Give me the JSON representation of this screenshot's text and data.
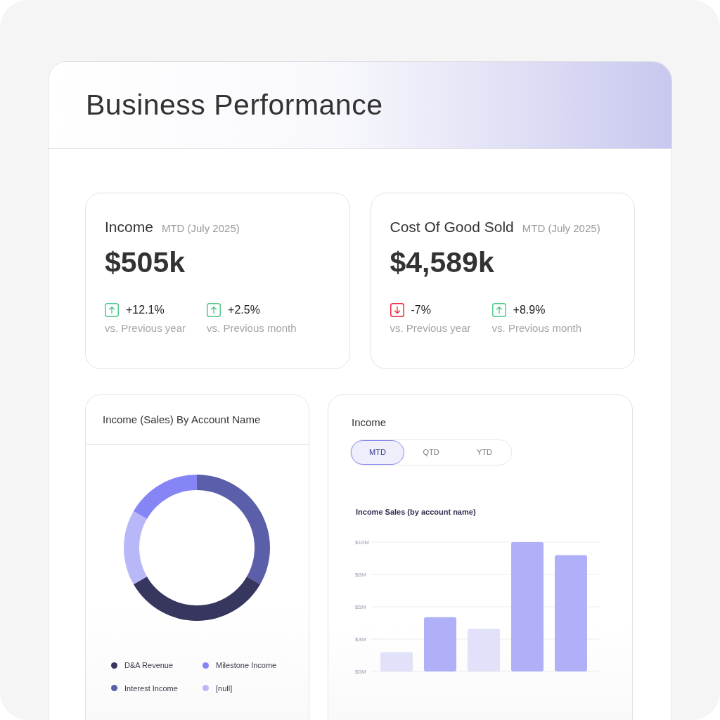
{
  "page": {
    "title": "Business Performance"
  },
  "kpi_cards": [
    {
      "title": "Income",
      "period": "MTD (July 2025)",
      "value": "$505k",
      "changes": [
        {
          "up": true,
          "value": "+12.1%",
          "label": "vs. Previous year"
        },
        {
          "up": true,
          "value": "+2.5%",
          "label": "vs. Previous month"
        }
      ]
    },
    {
      "title": "Cost Of Good Sold",
      "period": "MTD (July 2025)",
      "value": "$4,589k",
      "changes": [
        {
          "up": false,
          "value": "-7%",
          "label": "vs. Previous year"
        },
        {
          "up": true,
          "value": "+8.9%",
          "label": "vs. Previous month"
        }
      ]
    }
  ],
  "account_panel": {
    "title": "Income (Sales) By Account Name",
    "legend": [
      {
        "label": "D&A Revenue",
        "color": "#36365f"
      },
      {
        "label": "Milestone Income",
        "color": "#8585f5"
      },
      {
        "label": "Interest Income",
        "color": "#5b5ea8"
      },
      {
        "label": "[null]",
        "color": "#b8b8f8"
      }
    ]
  },
  "income_panel": {
    "title": "Income",
    "tabs": [
      {
        "label": "MTD",
        "selected": true
      },
      {
        "label": "QTD",
        "selected": false
      },
      {
        "label": "YTD",
        "selected": false
      }
    ],
    "chart_data": {
      "type": "bar",
      "title": "Income Sales (by account name)",
      "ylim": [
        0,
        10
      ],
      "yticks": [
        {
          "value": 0,
          "label": "$0M"
        },
        {
          "value": 2.5,
          "label": "$3M"
        },
        {
          "value": 5,
          "label": "$5M"
        },
        {
          "value": 7.5,
          "label": "$8M"
        },
        {
          "value": 10,
          "label": "$10M"
        }
      ],
      "grid": true,
      "stacked": true,
      "series": [
        {
          "color": "#e1e1f9",
          "values": [
            1.5,
            null,
            3.3,
            null,
            null
          ]
        },
        {
          "color": "#b0b0f8",
          "values": [
            null,
            4.2,
            null,
            10,
            9
          ]
        }
      ]
    }
  }
}
